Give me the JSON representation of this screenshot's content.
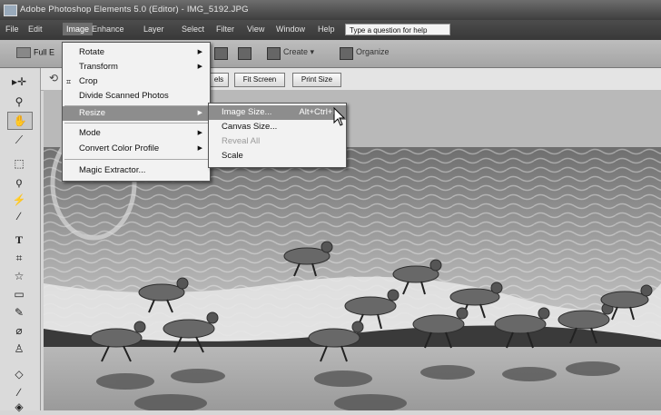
{
  "window": {
    "title": "Adobe Photoshop Elements 5.0 (Editor) - IMG_5192.JPG"
  },
  "menubar": {
    "items": [
      "File",
      "Edit",
      "Image",
      "Enhance",
      "Layer",
      "Select",
      "Filter",
      "View",
      "Window",
      "Help"
    ],
    "active": "Image",
    "help_placeholder": "Type a question for help"
  },
  "toolbar": {
    "full_edit_label": "Full E",
    "create_label": "Create ▾",
    "organize_label": "Organize"
  },
  "options_bar": {
    "buttons": [
      "els",
      "Fit Screen",
      "Print Size"
    ]
  },
  "image_menu": {
    "items": [
      {
        "label": "Rotate",
        "submenu": true
      },
      {
        "label": "Transform",
        "submenu": true
      },
      {
        "label": "Crop",
        "submenu": false
      },
      {
        "label": "Divide Scanned Photos",
        "submenu": false
      },
      {
        "label": "Resize",
        "submenu": true
      },
      {
        "label": "Mode",
        "submenu": true
      },
      {
        "label": "Convert Color Profile",
        "submenu": true
      },
      {
        "label": "Magic Extractor...",
        "submenu": false
      }
    ],
    "highlighted": "Resize"
  },
  "resize_submenu": {
    "items": [
      {
        "label": "Image Size...",
        "shortcut": "Alt+Ctrl+I",
        "enabled": true
      },
      {
        "label": "Canvas Size...",
        "shortcut": "",
        "enabled": true
      },
      {
        "label": "Reveal All",
        "shortcut": "",
        "enabled": false
      },
      {
        "label": "Scale",
        "shortcut": "",
        "enabled": true
      }
    ],
    "highlighted": "Image Size..."
  },
  "toolbox": {
    "tools": [
      "move-tool",
      "zoom-tool",
      "hand-tool",
      "eyedropper-tool",
      "marquee-tool",
      "lasso-tool",
      "magic-wand-tool",
      "brush-selection-tool",
      "type-tool",
      "crop-tool",
      "cookie-cutter-tool",
      "straighten-tool",
      "red-eye-tool",
      "healing-brush-tool",
      "clone-stamp-tool",
      "eraser-tool",
      "pencil-tool",
      "paint-bucket-tool"
    ]
  },
  "colors": {
    "titlebar": "#4a4a4a",
    "menu_highlight": "#8d8d8d",
    "menu_bg": "#f2f2f2"
  }
}
